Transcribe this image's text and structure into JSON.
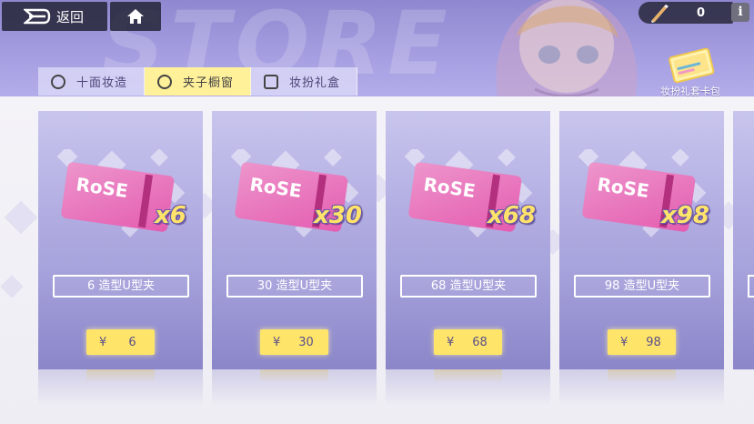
{
  "header": {
    "back_label": "返回",
    "bg_watermark": "STORE",
    "currency_value": "0",
    "info_label": "i",
    "gift_card_label": "妆扮礼套卡包"
  },
  "tabs": [
    {
      "label": "十面妆造",
      "icon": "hanger-icon",
      "active": false
    },
    {
      "label": "夹子橱窗",
      "icon": "clip-icon",
      "active": true
    },
    {
      "label": "妆扮礼盒",
      "icon": "gift-box-icon",
      "active": false
    }
  ],
  "products": [
    {
      "ticket_text": "RoSE",
      "qty_label": "x6",
      "name": "6 造型U型夹",
      "currency": "¥",
      "price": "6"
    },
    {
      "ticket_text": "RoSE",
      "qty_label": "x30",
      "name": "30 造型U型夹",
      "currency": "¥",
      "price": "30"
    },
    {
      "ticket_text": "RoSE",
      "qty_label": "x68",
      "name": "68 造型U型夹",
      "currency": "¥",
      "price": "68"
    },
    {
      "ticket_text": "RoSE",
      "qty_label": "x98",
      "name": "98 造型U型夹",
      "currency": "¥",
      "price": "98"
    }
  ],
  "colors": {
    "header_purple": "#a49de0",
    "tab_active": "#fff09a",
    "price_button": "#ffe46a",
    "ticket_pink": "#e45cb0"
  }
}
